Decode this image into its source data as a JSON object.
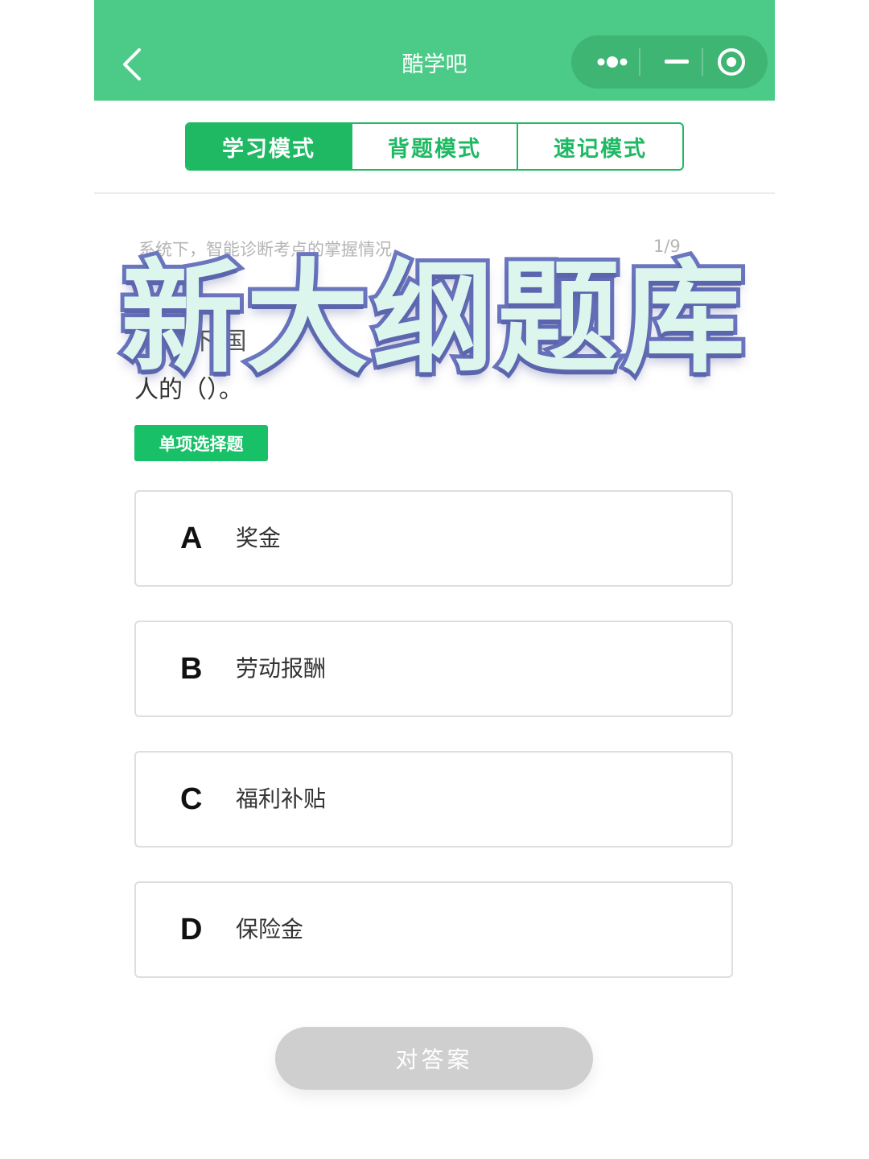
{
  "header": {
    "title": "酷学吧"
  },
  "tabs": [
    {
      "label": "学习模式",
      "active": true
    },
    {
      "label": "背题模式",
      "active": false
    },
    {
      "label": "速记模式",
      "active": false
    }
  ],
  "question": {
    "progress_hint": "系统下，智能诊断考点的掌握情况",
    "counter": "1/9",
    "text_partial": "的下 国",
    "text_tail": "人的（）。",
    "type_badge": "单项选择题"
  },
  "options": [
    {
      "letter": "A",
      "text": "奖金"
    },
    {
      "letter": "B",
      "text": "劳动报酬"
    },
    {
      "letter": "C",
      "text": "福利补贴"
    },
    {
      "letter": "D",
      "text": "保险金"
    }
  ],
  "answer_button": "对答案",
  "banner": "新大纲题库",
  "colors": {
    "header_green": "#4ccb88",
    "tab_green": "#1fb964",
    "badge_green": "#18c067",
    "banner_stroke": "#6c77c0"
  }
}
